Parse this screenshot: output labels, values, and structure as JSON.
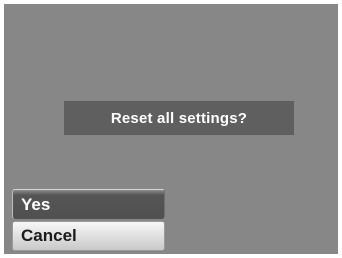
{
  "dialog": {
    "message": "Reset all settings?"
  },
  "menu": {
    "items": [
      {
        "label": "Yes",
        "selected": true
      },
      {
        "label": "Cancel",
        "selected": false
      }
    ]
  },
  "colors": {
    "screen_background": "#878787",
    "dialog_background": "#5f5f5f",
    "selected_item_background": "#505050",
    "normal_item_background": "#dcdcdc"
  }
}
